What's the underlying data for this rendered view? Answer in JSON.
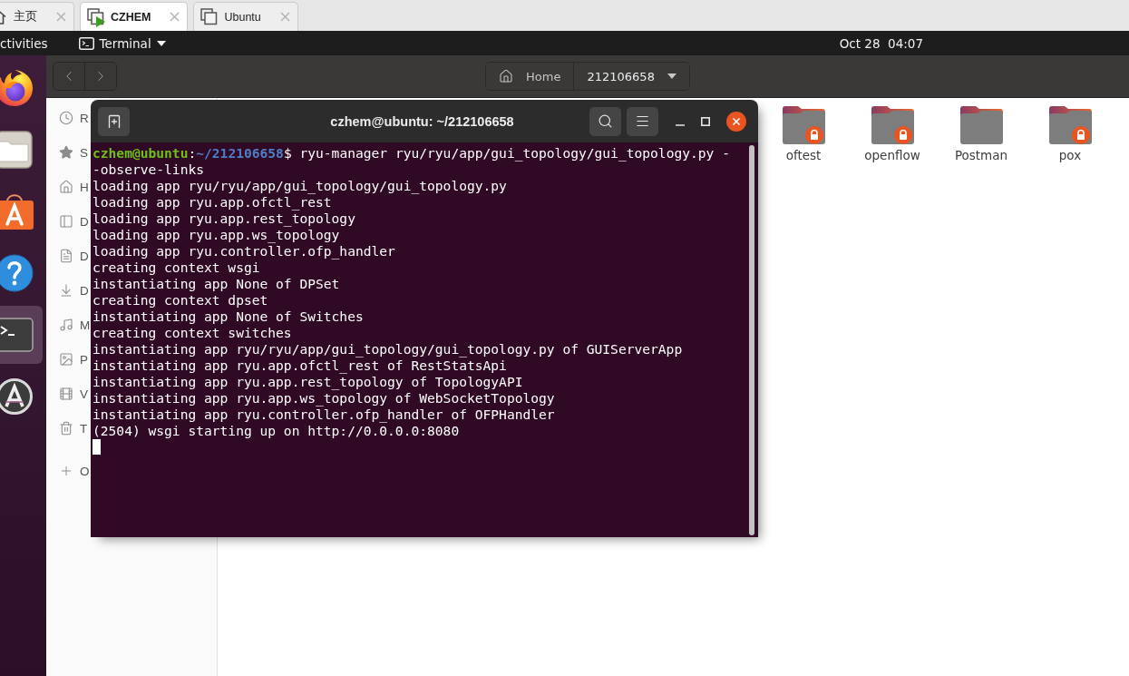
{
  "vm_tabs": [
    {
      "kind": "home",
      "label": "主页",
      "selected": false,
      "running": false
    },
    {
      "kind": "vm",
      "label": "CZHEM",
      "selected": true,
      "running": true
    },
    {
      "kind": "vm",
      "label": "Ubuntu",
      "selected": false,
      "running": false
    }
  ],
  "top_bar": {
    "activities": "ctivities",
    "app_menu": "Terminal",
    "clock": "Oct 28  04:07"
  },
  "dock": [
    {
      "selected": false
    },
    {
      "selected": false
    },
    {
      "selected": false
    },
    {
      "selected": false
    },
    {
      "selected": true
    },
    {
      "selected": false
    }
  ],
  "files": {
    "path_bar": [
      {
        "kind": "home",
        "label": "Home",
        "selected": false
      },
      {
        "kind": "folder",
        "label": "212106658",
        "selected": true
      }
    ],
    "sidebar": [
      "R",
      "S",
      "H",
      "D",
      "D",
      "D",
      "M",
      "P",
      "V",
      "T"
    ],
    "other_locations": "O",
    "folders": [
      {
        "name": "oftest",
        "locked": true
      },
      {
        "name": "openflow",
        "locked": true
      },
      {
        "name": "Postman",
        "locked": false
      },
      {
        "name": "pox",
        "locked": true
      }
    ]
  },
  "terminal": {
    "title": "czhem@ubuntu: ~/212106658",
    "lines": [
      {
        "kind": "prompt",
        "user": "czhem@ubuntu",
        "separator": ":",
        "path": "~/212106658",
        "text": "$ ryu-manager ryu/ryu/app/gui_topology/gui_topology.py -"
      },
      {
        "kind": "output",
        "text": "-observe-links"
      },
      {
        "kind": "output",
        "text": "loading app ryu/ryu/app/gui_topology/gui_topology.py"
      },
      {
        "kind": "output",
        "text": "loading app ryu.app.ofctl_rest"
      },
      {
        "kind": "output",
        "text": "loading app ryu.app.rest_topology"
      },
      {
        "kind": "output",
        "text": "loading app ryu.app.ws_topology"
      },
      {
        "kind": "output",
        "text": "loading app ryu.controller.ofp_handler"
      },
      {
        "kind": "output",
        "text": "creating context wsgi"
      },
      {
        "kind": "output",
        "text": "instantiating app None of DPSet"
      },
      {
        "kind": "output",
        "text": "creating context dpset"
      },
      {
        "kind": "output",
        "text": "instantiating app None of Switches"
      },
      {
        "kind": "output",
        "text": "creating context switches"
      },
      {
        "kind": "output",
        "text": "instantiating app ryu/ryu/app/gui_topology/gui_topology.py of GUIServerApp"
      },
      {
        "kind": "output",
        "text": "instantiating app ryu.app.ofctl_rest of RestStatsApi"
      },
      {
        "kind": "output",
        "text": "instantiating app ryu.app.rest_topology of TopologyAPI"
      },
      {
        "kind": "output",
        "text": "instantiating app ryu.app.ws_topology of WebSocketTopology"
      },
      {
        "kind": "output",
        "text": "instantiating app ryu.controller.ofp_handler of OFPHandler"
      },
      {
        "kind": "output",
        "text": "(2504) wsgi starting up on http://0.0.0.0:8080"
      }
    ]
  }
}
